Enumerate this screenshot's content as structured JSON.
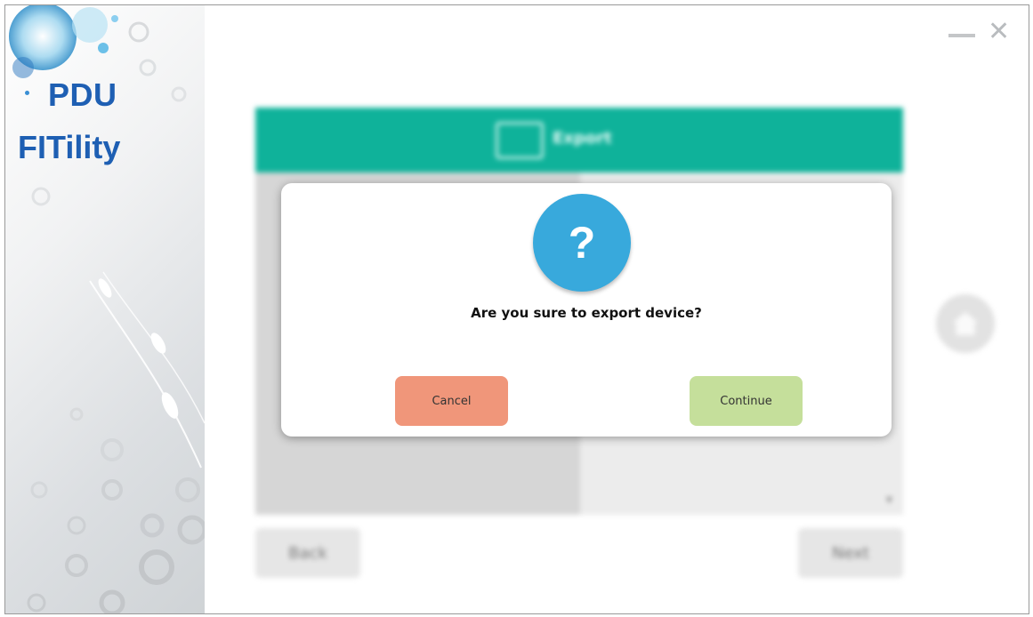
{
  "app": {
    "brand_line1": "PDU",
    "brand_line2": "FITility"
  },
  "window_controls": {
    "minimize_icon": "minimize-icon",
    "close_icon": "close-icon",
    "close_glyph": "✕"
  },
  "background": {
    "panel_title": "Export",
    "back_label": "Back",
    "next_label": "Next",
    "scroll_glyph": "▼"
  },
  "dialog": {
    "icon": "question-icon",
    "icon_glyph": "?",
    "message": "Are you sure to export device?",
    "cancel_label": "Cancel",
    "continue_label": "Continue"
  },
  "colors": {
    "header_teal": "#0fb29a",
    "question_blue": "#38a9dc",
    "cancel_salmon": "#f0967a",
    "continue_green": "#c5df9b",
    "brand_blue": "#1e5fb3"
  }
}
